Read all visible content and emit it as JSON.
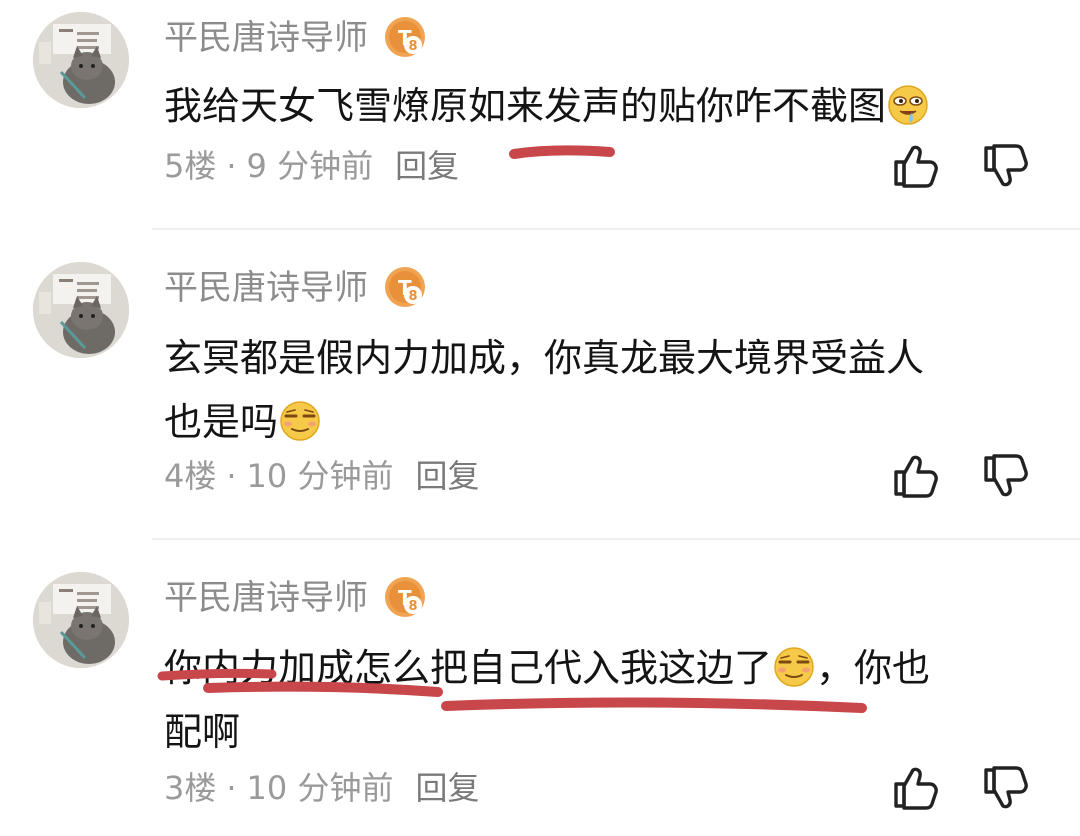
{
  "comments": [
    {
      "username": "平民唐诗导师",
      "level": "8",
      "content_lines": [
        "我给天女飞雪燎原如来发声的贴你咋不截图"
      ],
      "floor": "5楼",
      "time": "9 分钟前",
      "reply_label": "回复"
    },
    {
      "username": "平民唐诗导师",
      "level": "8",
      "content_lines": [
        "玄冥都是假内力加成，你真龙最大境界受益人",
        "也是吗"
      ],
      "floor": "4楼",
      "time": "10 分钟前",
      "reply_label": "回复"
    },
    {
      "username": "平民唐诗导师",
      "level": "8",
      "content_lines": [
        "你内力加成怎么把自己代入我这边了",
        "，你也",
        "配啊"
      ],
      "floor": "3楼",
      "time": "10 分钟前",
      "reply_label": "回复"
    }
  ],
  "meta_separator": "·",
  "icons": {
    "like": "thumbs-up-icon",
    "dislike": "thumbs-down-icon",
    "emoji_1": "drooling-face-emoji",
    "emoji_2": "smirk-face-emoji"
  },
  "colors": {
    "username": "#8c8c8c",
    "content": "#141414",
    "meta": "#9a9a9a",
    "level_badge": "#e8913a",
    "annotation": "#c8474a"
  }
}
